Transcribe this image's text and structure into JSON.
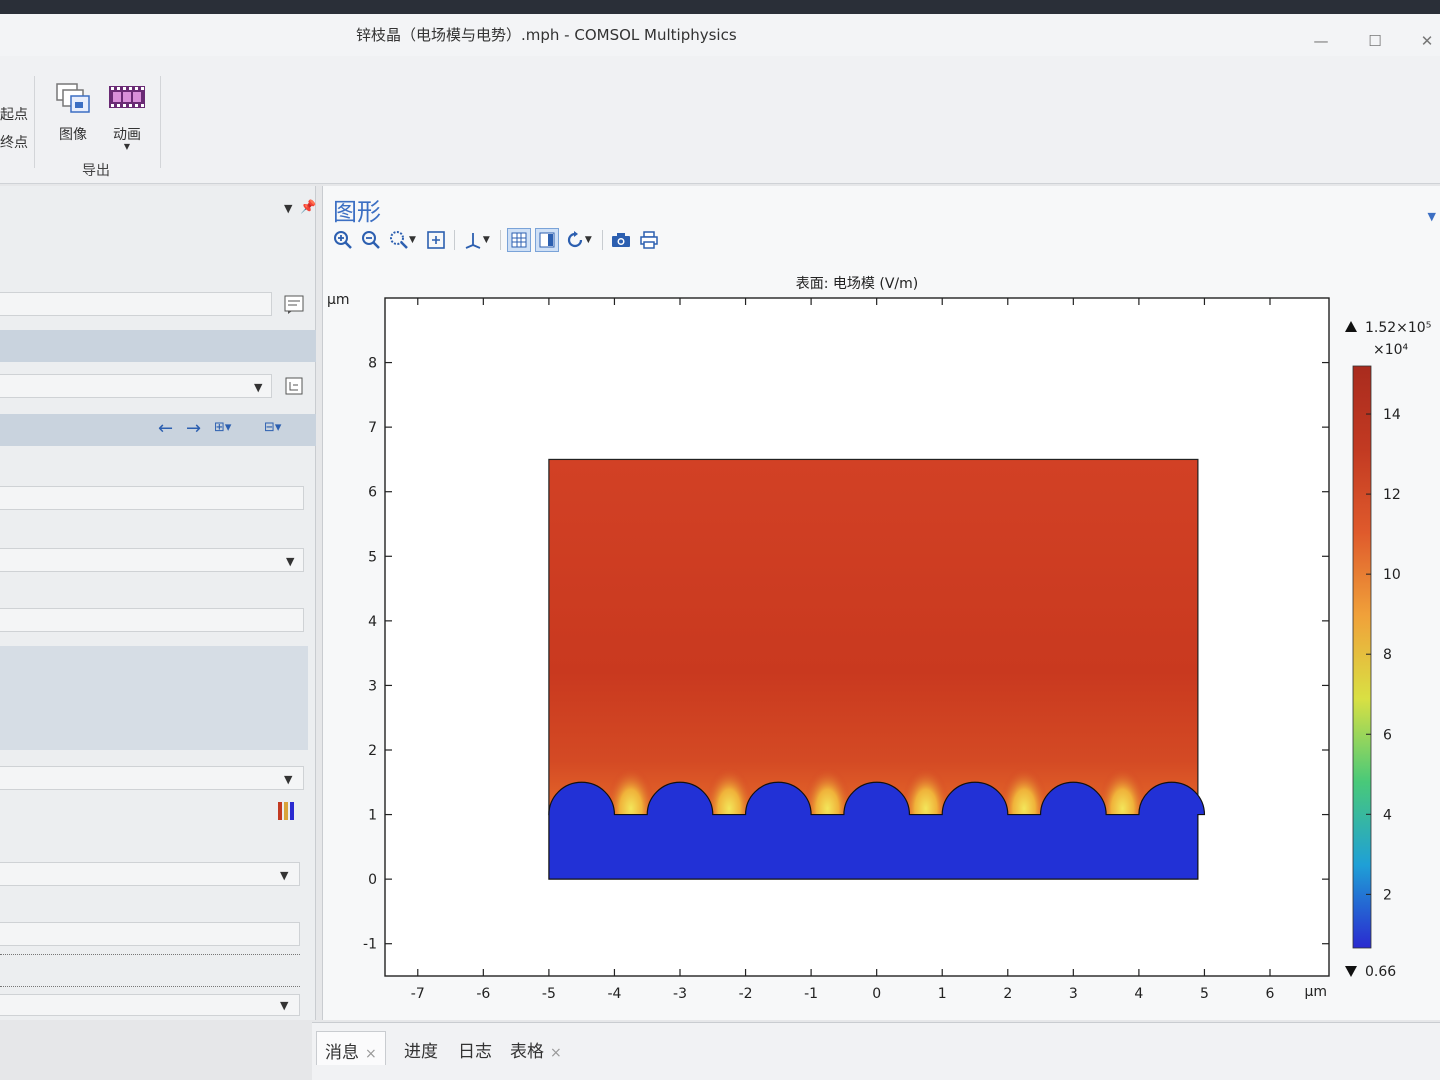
{
  "window": {
    "title": "锌枝晶（电场模与电势）.mph - COMSOL Multiphysics",
    "minimize_glyph": "—",
    "maximize_glyph": "☐",
    "close_glyph": "✕"
  },
  "ribbon": {
    "cut_label_1": "起点",
    "cut_label_2": "终点",
    "image_label": "图像",
    "animation_label": "动画",
    "group_label": "导出",
    "image_icon": "image-export-icon",
    "animation_icon": "film-strip-icon"
  },
  "graphics": {
    "panel_title": "图形",
    "toolbar_icons": [
      "zoom-in-icon",
      "zoom-out-icon",
      "zoom-box-icon",
      "zoom-extents-icon",
      "axis-orientation-icon",
      "grid-icon",
      "axis-toggle-icon",
      "reset-view-icon",
      "camera-icon",
      "print-icon"
    ]
  },
  "chart_data": {
    "type": "heatmap",
    "title": "表面: 电场模 (V/m)",
    "x_unit": "μm",
    "y_unit": "μm",
    "xlim": [
      -7.5,
      6.9
    ],
    "ylim": [
      -1.5,
      9.0
    ],
    "x_ticks": [
      -7,
      -6,
      -5,
      -4,
      -3,
      -2,
      -1,
      0,
      1,
      2,
      3,
      4,
      5,
      6
    ],
    "y_ticks": [
      -1,
      0,
      1,
      2,
      3,
      4,
      5,
      6,
      7,
      8
    ],
    "domain": {
      "electrolyte": {
        "x": [
          -5,
          4.9
        ],
        "y": [
          0,
          6.5
        ]
      },
      "electrode_top_y": 1.0,
      "dendrite_centers_x": [
        -4.5,
        -3.0,
        -1.5,
        0.0,
        1.5,
        3.0,
        4.5
      ],
      "dendrite_radius": 0.5
    },
    "colorbar": {
      "max_label": "1.52×10⁵",
      "scale_label": "×10⁴",
      "min_label": "0.66",
      "range": [
        0.66,
        15.2
      ],
      "tick_values": [
        2,
        4,
        6,
        8,
        10,
        12,
        14
      ],
      "tick_labels": [
        "2",
        "4",
        "6",
        "8",
        "10",
        "12",
        "14"
      ],
      "colormap": [
        "#2a2ad0",
        "#1fa0d6",
        "#49c979",
        "#d9e043",
        "#f0a13a",
        "#df5a2c",
        "#c23a22",
        "#a92b1e"
      ]
    },
    "colors": {
      "bulk_field": "#cf3e22",
      "electrode": "#2231d6",
      "hotspot": "#f3e65a",
      "background": "#ffffff"
    }
  },
  "bottom_tabs": [
    {
      "label": "消息",
      "closable": true,
      "active": true
    },
    {
      "label": "进度",
      "closable": false,
      "active": false
    },
    {
      "label": "日志",
      "closable": false,
      "active": false
    },
    {
      "label": "表格",
      "closable": true,
      "active": false
    }
  ],
  "close_glyph": "×"
}
